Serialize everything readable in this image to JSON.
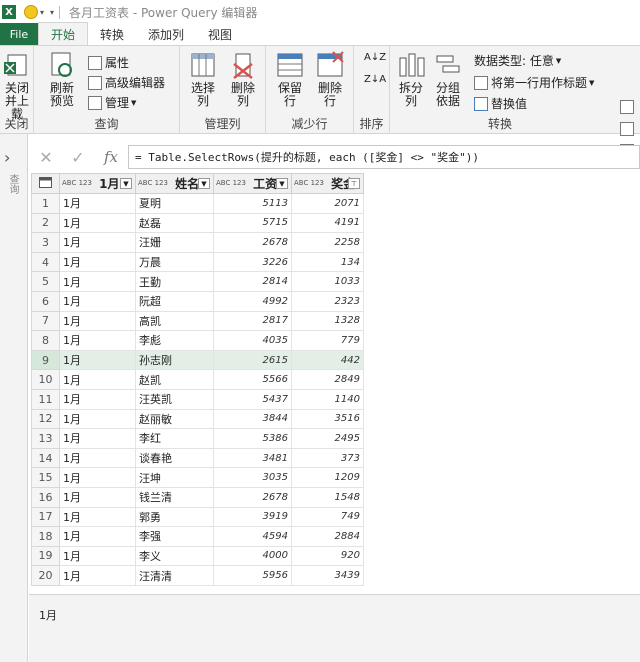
{
  "window": {
    "title": "各月工资表 - Power Query 编辑器",
    "app_icon": "X"
  },
  "tabs": [
    "File",
    "开始",
    "转换",
    "添加列",
    "视图"
  ],
  "ribbon": {
    "close_group": {
      "button": "关闭并上载",
      "label": "关闭"
    },
    "query_group": {
      "refresh": "刷新预览",
      "properties": "属性",
      "advanced": "高级编辑器",
      "manage": "管理",
      "label": "查询"
    },
    "columns_group": {
      "choose": "选择列",
      "remove": "删除列",
      "label": "管理列"
    },
    "rows_group": {
      "keep": "保留行",
      "remove": "删除行",
      "label": "减少行"
    },
    "sort_group": {
      "label": "排序"
    },
    "transform_group": {
      "split": "拆分列",
      "group": "分组依据",
      "datatype": "数据类型: 任意",
      "first_row": "将第一行用作标题",
      "replace": "替换值",
      "label": "转换"
    }
  },
  "side_panel": {
    "label": "查询"
  },
  "formula": {
    "text": "= Table.SelectRows(提升的标题, each ([奖金] <> \"奖金\"))",
    "fx": "fx"
  },
  "grid": {
    "type_tag": "ABC 123",
    "columns": [
      "1月",
      "姓名",
      "工资",
      "奖金"
    ],
    "rows": [
      [
        "1",
        "1月",
        "夏明",
        "5113",
        "2071"
      ],
      [
        "2",
        "1月",
        "赵磊",
        "5715",
        "4191"
      ],
      [
        "3",
        "1月",
        "汪姗",
        "2678",
        "2258"
      ],
      [
        "4",
        "1月",
        "万晨",
        "3226",
        "134"
      ],
      [
        "5",
        "1月",
        "王勤",
        "2814",
        "1033"
      ],
      [
        "6",
        "1月",
        "阮超",
        "4992",
        "2323"
      ],
      [
        "7",
        "1月",
        "高凯",
        "2817",
        "1328"
      ],
      [
        "8",
        "1月",
        "李彪",
        "4035",
        "779"
      ],
      [
        "9",
        "1月",
        "孙志刚",
        "2615",
        "442"
      ],
      [
        "10",
        "1月",
        "赵凯",
        "5566",
        "2849"
      ],
      [
        "11",
        "1月",
        "汪英凯",
        "5437",
        "1140"
      ],
      [
        "12",
        "1月",
        "赵丽敏",
        "3844",
        "3516"
      ],
      [
        "13",
        "1月",
        "李红",
        "5386",
        "2495"
      ],
      [
        "14",
        "1月",
        "谈春艳",
        "3481",
        "373"
      ],
      [
        "15",
        "1月",
        "汪坤",
        "3035",
        "1209"
      ],
      [
        "16",
        "1月",
        "钱兰清",
        "2678",
        "1548"
      ],
      [
        "17",
        "1月",
        "郭勇",
        "3919",
        "749"
      ],
      [
        "18",
        "1月",
        "李强",
        "4594",
        "2884"
      ],
      [
        "19",
        "1月",
        "李义",
        "4000",
        "920"
      ],
      [
        "20",
        "1月",
        "汪清清",
        "5956",
        "3439"
      ]
    ],
    "selected_row": 9
  },
  "preview": {
    "value": "1月"
  },
  "colors": {
    "accent": "#217346",
    "selected": "#e3efe6"
  }
}
